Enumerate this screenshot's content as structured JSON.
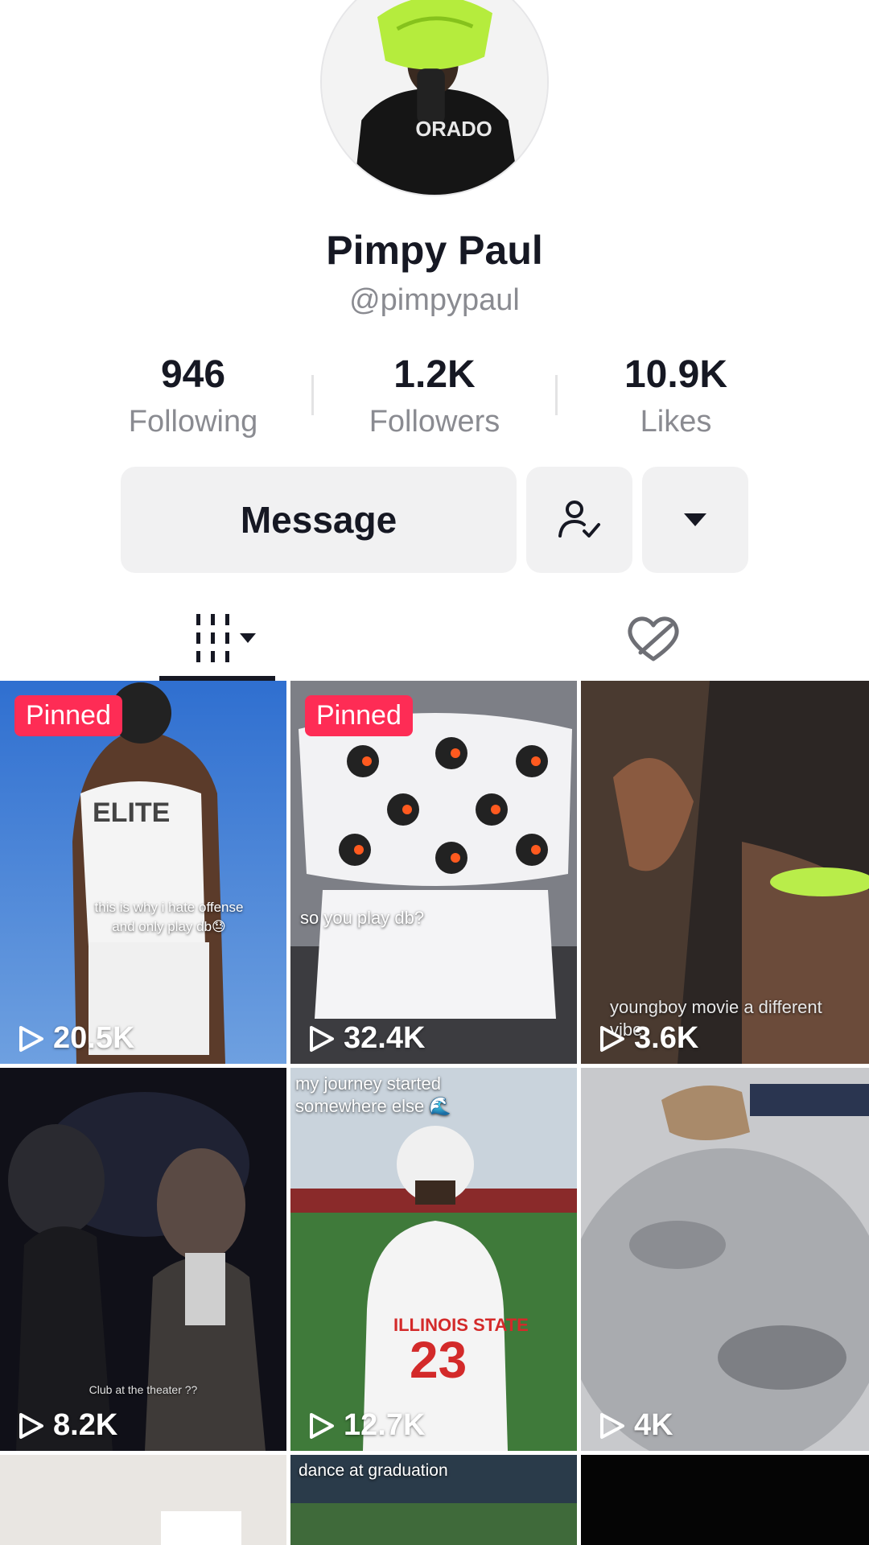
{
  "profile": {
    "name": "Pimpy Paul",
    "handle": "@pimpypaul",
    "jersey_text": "ORADO"
  },
  "stats": [
    {
      "value": "946",
      "label": "Following"
    },
    {
      "value": "1.2K",
      "label": "Followers"
    },
    {
      "value": "10.9K",
      "label": "Likes"
    }
  ],
  "actions": {
    "message_label": "Message",
    "follow_icon": "user-check-icon",
    "more_icon": "caret-down-icon"
  },
  "tabs": {
    "videos_icon": "grid-bars-icon",
    "liked_icon": "hidden-heart-icon"
  },
  "videos": [
    {
      "pinned": "Pinned",
      "views": "20.5K",
      "caption": "this is why i hate offense and  only play db😓",
      "jersey": "ELITE"
    },
    {
      "pinned": "Pinned",
      "views": "32.4K",
      "caption": "so you play db?"
    },
    {
      "views": "3.6K",
      "caption": "youngboy movie a different vibe"
    },
    {
      "views": "8.2K",
      "caption": "Club at the theater ??"
    },
    {
      "views": "12.7K",
      "caption": "my journey started somewhere else 🌊",
      "jersey": "ILLINOIS STATE",
      "number": "23"
    },
    {
      "views": "4K"
    },
    {
      "caption": "dance at graduation"
    }
  ],
  "colors": {
    "accent": "#fe2c55",
    "text_primary": "#161823",
    "text_secondary": "#8a8b91",
    "button_bg": "#f1f1f2"
  }
}
